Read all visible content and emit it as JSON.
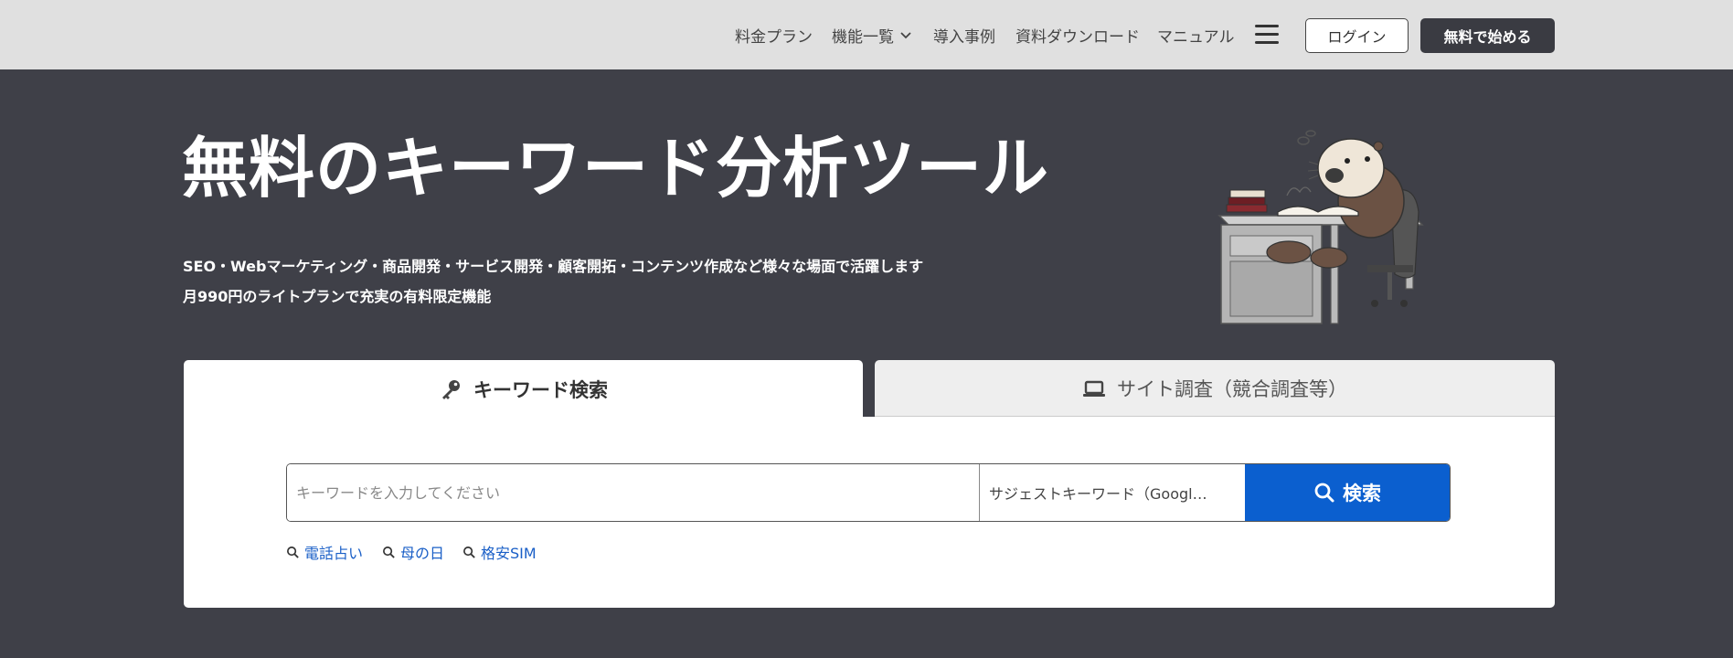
{
  "nav": {
    "items": [
      {
        "label": "料金プラン"
      },
      {
        "label": "機能一覧",
        "icon": "chevron-down-icon"
      },
      {
        "label": "導入事例"
      },
      {
        "label": "資料ダウンロード"
      },
      {
        "label": "マニュアル"
      }
    ],
    "menu_icon": "hamburger-menu-icon",
    "login_label": "ログイン",
    "start_label": "無料で始める"
  },
  "hero": {
    "title": "無料のキーワード分析ツール",
    "subtitle_1": "SEO・Webマーケティング・商品開発・サービス開発・顧客開拓・コンテンツ作成など様々な場面で活躍します",
    "subtitle_2": "月990円のライトプランで充実の有料限定機能"
  },
  "tabs": [
    {
      "label": "キーワード検索",
      "icon": "key-icon",
      "active": true
    },
    {
      "label": "サイト調査（競合調査等）",
      "icon": "laptop-icon",
      "active": false
    }
  ],
  "search": {
    "input_value": "",
    "placeholder": "キーワードを入力してください",
    "select_value": "サジェストキーワード（Googl…",
    "button_label": "検索",
    "button_icon": "search-icon"
  },
  "suggestions": [
    "電話占い",
    "母の日",
    "格安SIM"
  ],
  "colors": {
    "header_bg": "#e0e0e0",
    "hero_bg": "#3f4048",
    "primary_blue": "#0b5fcf",
    "link_blue": "#1a5fc7",
    "dark_button": "#3a3b42"
  }
}
